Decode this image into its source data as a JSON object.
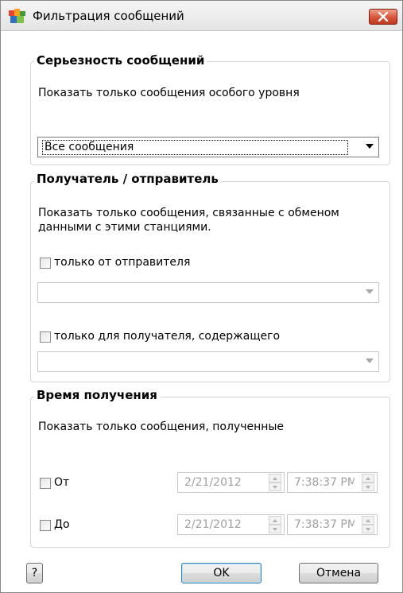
{
  "window": {
    "title": "Фильтрация сообщений"
  },
  "severity": {
    "group_title": "Серьезность сообщений",
    "description": "Показать только сообщения особого уровня",
    "selected": "Все сообщения"
  },
  "recipient": {
    "group_title": "Получатель / отправитель",
    "description_line1": "Показать только сообщения, связанные с обменом",
    "description_line2": "данными с этими станциями.",
    "sender_label": "только от отправителя",
    "sender_value": "",
    "receiver_label": "только для получателя, содержащего",
    "receiver_value": ""
  },
  "time": {
    "group_title": "Время получения",
    "description": "Показать только сообщения, полученные",
    "from_label": "От",
    "from_date": "2/21/2012",
    "from_time": "7:38:37 PM",
    "to_label": "До",
    "to_date": "2/21/2012",
    "to_time": "7:38:37 PM"
  },
  "buttons": {
    "help": "?",
    "ok": "OK",
    "cancel": "Отмена"
  },
  "colors": {
    "close_button": "#d6543a",
    "group_border": "#d6d6d6",
    "disabled_text": "#a0a0a0"
  }
}
